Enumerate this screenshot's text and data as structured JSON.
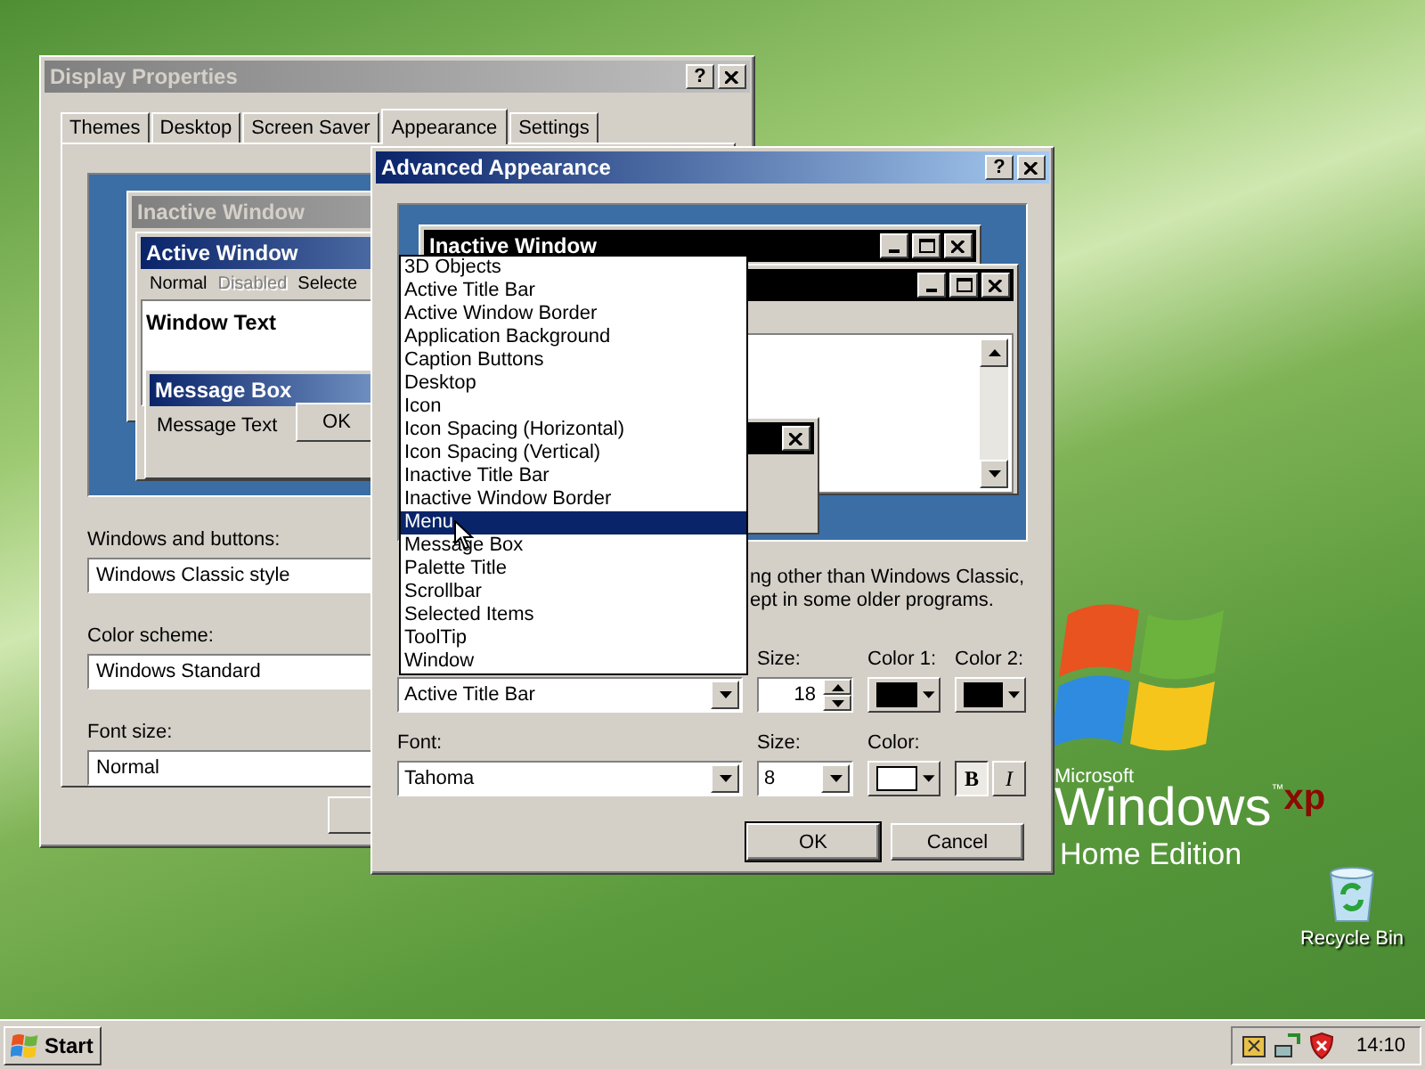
{
  "display_properties": {
    "title": "Display Properties",
    "active": false,
    "help": "?",
    "tabs": [
      {
        "label": "Themes",
        "selected": false
      },
      {
        "label": "Desktop",
        "selected": false
      },
      {
        "label": "Screen Saver",
        "selected": false
      },
      {
        "label": "Appearance",
        "selected": true
      },
      {
        "label": "Settings",
        "selected": false
      }
    ],
    "preview": {
      "inactive_title": "Inactive Window",
      "active_title": "Active Window",
      "menu": [
        {
          "label": "Normal",
          "disabled": false
        },
        {
          "label": "Disabled",
          "disabled": true
        },
        {
          "label": "Selecte",
          "disabled": false
        }
      ],
      "window_text": "Window Text",
      "message_title": "Message Box",
      "message_text": "Message Text",
      "ok": "OK"
    },
    "fields": [
      {
        "label": "Windows and buttons:",
        "value": "Windows Classic style"
      },
      {
        "label": "Color scheme:",
        "value": "Windows Standard"
      },
      {
        "label": "Font size:",
        "value": "Normal"
      }
    ]
  },
  "advanced": {
    "title": "Advanced Appearance",
    "active": true,
    "help": "?",
    "preview": {
      "inactive_title": "Inactive Window"
    },
    "item_list": [
      {
        "label": "3D Objects",
        "selected": false
      },
      {
        "label": "Active Title Bar",
        "selected": false
      },
      {
        "label": "Active Window Border",
        "selected": false
      },
      {
        "label": "Application Background",
        "selected": false
      },
      {
        "label": "Caption Buttons",
        "selected": false
      },
      {
        "label": "Desktop",
        "selected": false
      },
      {
        "label": "Icon",
        "selected": false
      },
      {
        "label": "Icon Spacing (Horizontal)",
        "selected": false
      },
      {
        "label": "Icon Spacing (Vertical)",
        "selected": false
      },
      {
        "label": "Inactive Title Bar",
        "selected": false
      },
      {
        "label": "Inactive Window Border",
        "selected": false
      },
      {
        "label": "Menu",
        "selected": true
      },
      {
        "label": "Message Box",
        "selected": false
      },
      {
        "label": "Palette Title",
        "selected": false
      },
      {
        "label": "Scrollbar",
        "selected": false
      },
      {
        "label": "Selected Items",
        "selected": false
      },
      {
        "label": "ToolTip",
        "selected": false
      },
      {
        "label": "Window",
        "selected": false
      }
    ],
    "note_lines": [
      "ng other than Windows Classic,",
      "ept in some older programs."
    ],
    "item_value": "Active Title Bar",
    "size_label": "Size:",
    "size": "18",
    "color1": {
      "label": "Color 1:",
      "color": "#000000"
    },
    "color2": {
      "label": "Color 2:",
      "color": "#000000"
    },
    "font_label": "Font:",
    "font": "Tahoma",
    "font_size_label": "Size:",
    "font_size": "8",
    "font_color": {
      "label": "Color:",
      "color": "#ffffff"
    },
    "bold": {
      "label": "B",
      "selected": true
    },
    "italic": {
      "label": "I",
      "selected": false
    },
    "buttons": [
      "OK",
      "Cancel"
    ]
  },
  "desktop": {
    "logo": {
      "brand": "Microsoft",
      "product": "Windows",
      "tm": "™",
      "superscript": "xp",
      "edition": "Home Edition"
    },
    "icons": [
      {
        "label": "Recycle Bin"
      }
    ]
  },
  "taskbar": {
    "start": "Start",
    "clock": "14:10"
  }
}
